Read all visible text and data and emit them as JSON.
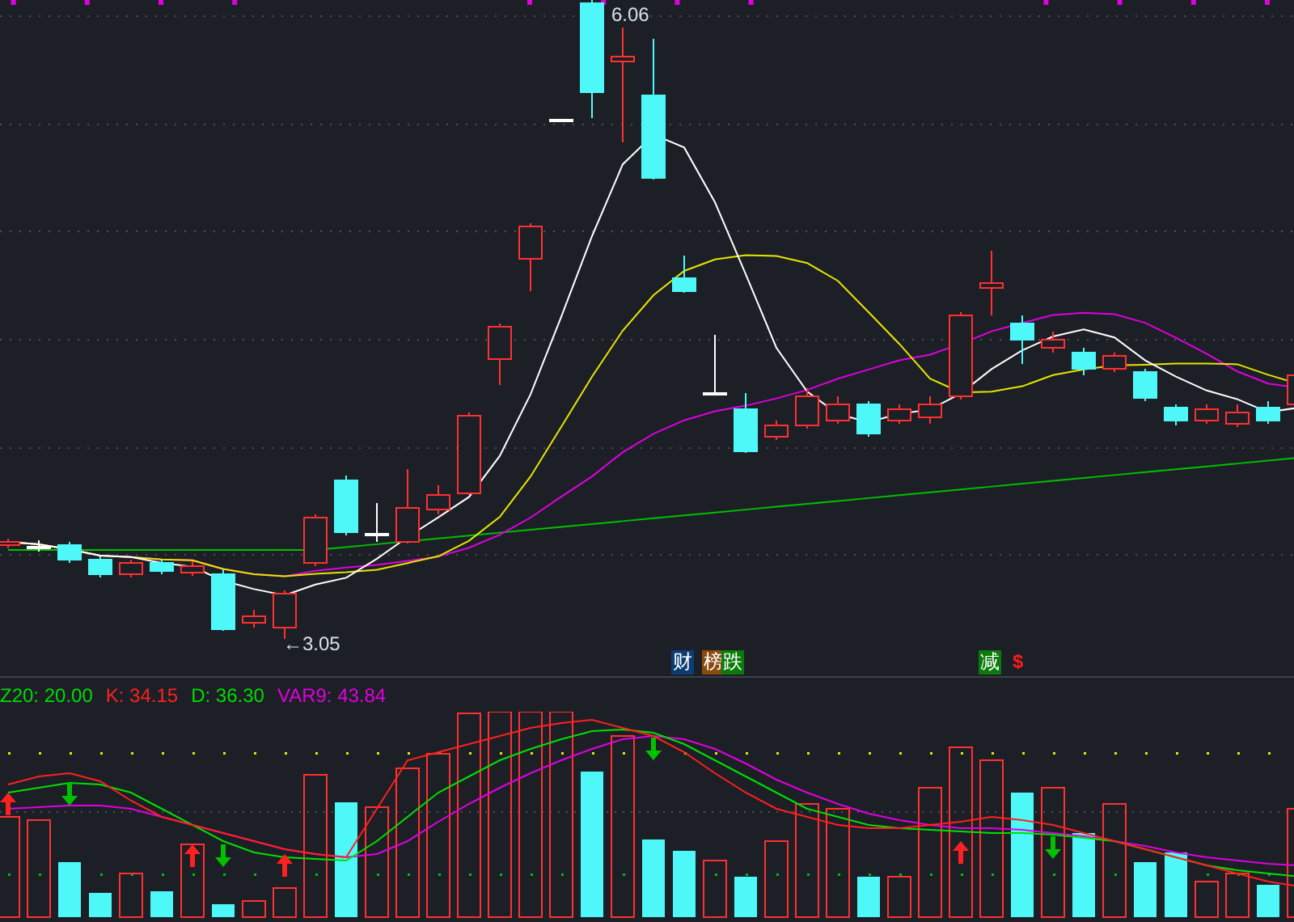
{
  "chart": {
    "high_label": "6.06",
    "low_label": "←3.05"
  },
  "markers": [
    {
      "text": "财",
      "kind": "box",
      "color": "#0b3d73"
    },
    {
      "text": "榜",
      "kind": "box",
      "color": "#8a4a0e"
    },
    {
      "text": "跌",
      "kind": "box",
      "color": "#0a7a0a"
    },
    {
      "text": "减",
      "kind": "box",
      "color": "#0a7a0a"
    },
    {
      "text": "$",
      "kind": "glyph",
      "color": "#ff1a1a"
    }
  ],
  "legend": [
    {
      "text": "Z20: 20.00",
      "color": "#00dd00"
    },
    {
      "text": "K: 34.15",
      "color": "#ff2020"
    },
    {
      "text": "D: 36.30",
      "color": "#00dd00"
    },
    {
      "text": "VAR9: 43.84",
      "color": "#e000e0"
    }
  ]
}
